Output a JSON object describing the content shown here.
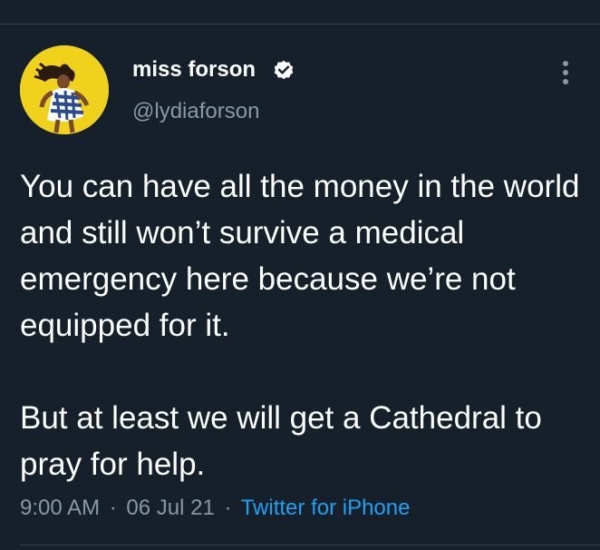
{
  "tweet": {
    "author": {
      "display_name": "miss forson",
      "handle": "@lydiaforson",
      "verified": true,
      "avatar_icon": "profile-photo-icon"
    },
    "text_paragraphs": [
      "You can have all the money in the world and still won’t survive a medical emergency here because we’re not equipped for it.",
      "But at least we will get a Cathedral to pray for help."
    ],
    "time": "9:00 AM",
    "date": "06 Jul 21",
    "separator": "·",
    "source": "Twitter for iPhone"
  },
  "colors": {
    "background": "#15202b",
    "text": "#ffffff",
    "secondary_text": "#8899a6",
    "link": "#1da1f2",
    "divider": "#38444d",
    "avatar_bg": "#f0d21c"
  },
  "icons": {
    "verified": "verified-badge-icon",
    "more": "more-vertical-icon"
  }
}
